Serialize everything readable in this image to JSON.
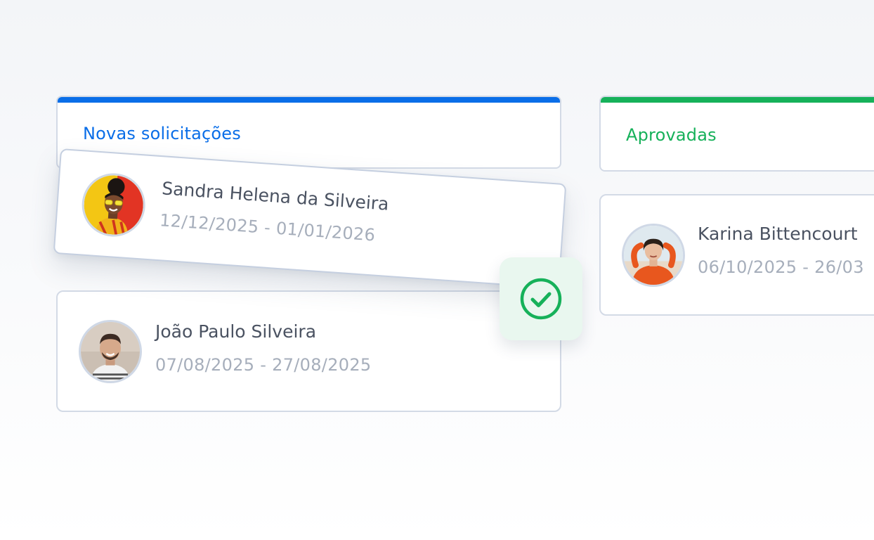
{
  "columns": {
    "novas": {
      "title": "Novas solicitações",
      "accent": "#0a6ee8"
    },
    "aprovadas": {
      "title": "Aprovadas",
      "accent": "#16b15a"
    }
  },
  "requests": {
    "sandra": {
      "name": "Sandra Helena da Silveira",
      "dates": "12/12/2025 - 01/01/2026",
      "avatar_icon": "avatar-photo"
    },
    "joao": {
      "name": "João Paulo Silveira",
      "dates": "07/08/2025 - 27/08/2025",
      "avatar_icon": "avatar-photo"
    },
    "karina": {
      "name": "Karina Bittencourt",
      "dates": "06/10/2025 - 26/03",
      "avatar_icon": "avatar-photo"
    }
  },
  "approve": {
    "icon": "check-circle-icon",
    "color": "#16b15a"
  }
}
